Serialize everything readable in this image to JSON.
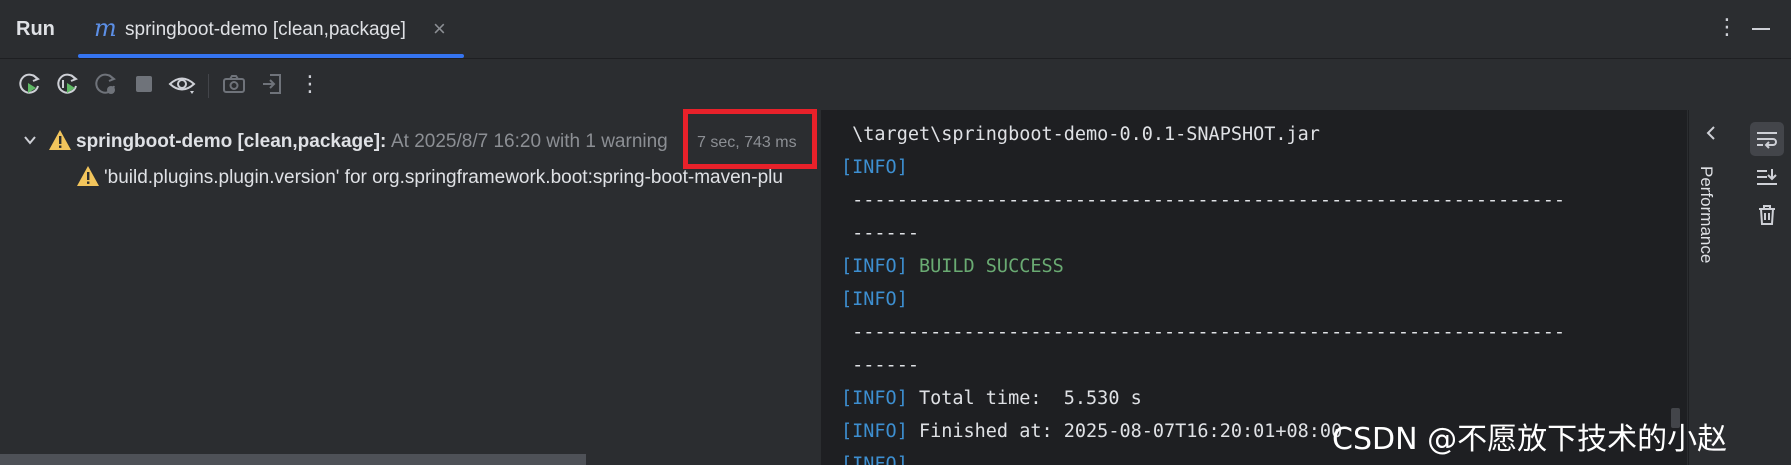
{
  "toolwindow": {
    "title": "Run",
    "tab": {
      "icon": "maven-m-icon",
      "label": "springboot-demo [clean,package]",
      "close": "×"
    },
    "more_icon": "kebab-icon",
    "minimize_icon": "minimize-icon"
  },
  "toolbar": {
    "buttons": [
      "rerun-icon",
      "rerun-failed-icon",
      "rerun-automatically-icon",
      "stop-icon",
      "eye-icon",
      "camera-icon",
      "export-icon",
      "more-vertical-icon"
    ]
  },
  "tree": {
    "root": {
      "name": "springboot-demo [clean,package]:",
      "meta": "At 2025/8/7 16:20 with 1 warning",
      "duration": "7 sec, 743 ms"
    },
    "warning": {
      "text": "'build.plugins.plugin.version' for org.springframework.boot:spring-boot-maven-plu"
    }
  },
  "console": {
    "lines": [
      {
        "tag": "",
        "text": " \\target\\springboot-demo-0.0.1-SNAPSHOT.jar"
      },
      {
        "tag": "[INFO]",
        "text": ""
      },
      {
        "tag": "",
        "text": " ----------------------------------------------------------------"
      },
      {
        "tag": "",
        "text": " ------"
      },
      {
        "tag": "[INFO]",
        "text": "BUILD SUCCESS"
      },
      {
        "tag": "[INFO]",
        "text": ""
      },
      {
        "tag": "",
        "text": " ----------------------------------------------------------------"
      },
      {
        "tag": "",
        "text": " ------"
      },
      {
        "tag": "[INFO]",
        "text": "Total time:  5.530 s"
      },
      {
        "tag": "[INFO]",
        "text": "Finished at: 2025-08-07T16:20:01+08:00"
      },
      {
        "tag": "[INFO]",
        "text": ""
      }
    ]
  },
  "side_panel": {
    "label": "Performance"
  },
  "side_tools": [
    "soft-wrap-icon",
    "scroll-to-end-icon",
    "trash-icon"
  ],
  "watermark": "CSDN @不愿放下技术的小赵",
  "colors": {
    "accent": "#3574f0",
    "info": "#3d8fd1",
    "success": "#6aab73",
    "warning": "#f2c55c",
    "highlight": "#e8212a"
  }
}
